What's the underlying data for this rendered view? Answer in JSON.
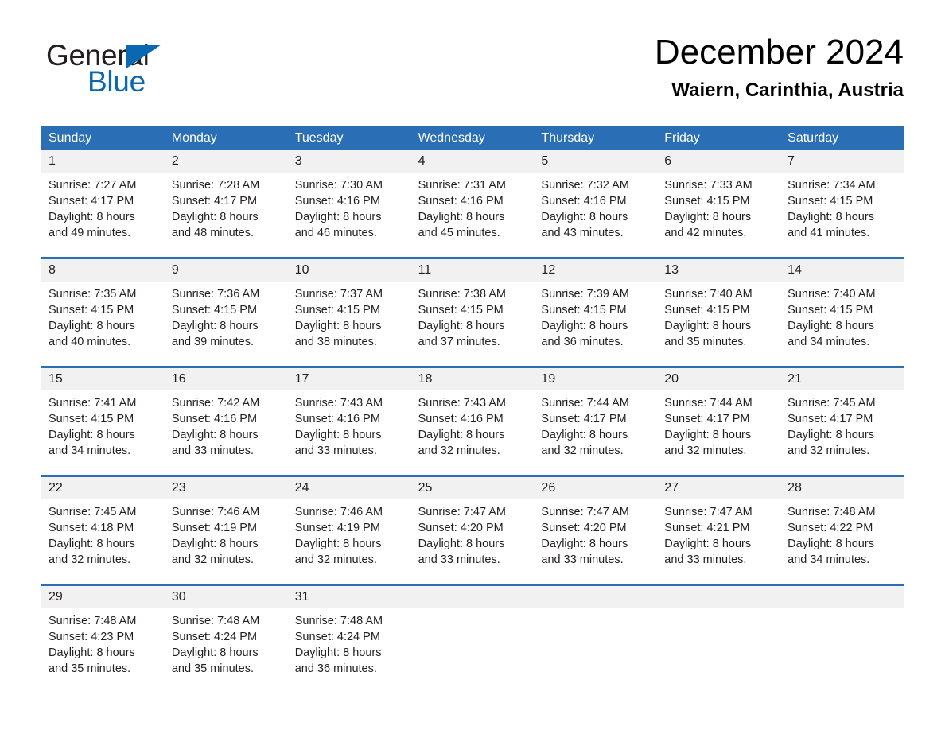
{
  "brand": {
    "name_part1": "General",
    "name_part2": "Blue",
    "triangle_color": "#0a67b1"
  },
  "header": {
    "title": "December 2024",
    "location": "Waiern, Carinthia, Austria"
  },
  "theme": {
    "header_blue": "#2a6fb5",
    "daynum_band": "#f1f1f1",
    "text": "#231f20"
  },
  "weekdays": [
    "Sunday",
    "Monday",
    "Tuesday",
    "Wednesday",
    "Thursday",
    "Friday",
    "Saturday"
  ],
  "weeks": [
    {
      "days": [
        {
          "num": "1",
          "sunrise": "Sunrise: 7:27 AM",
          "sunset": "Sunset: 4:17 PM",
          "daylight1": "Daylight: 8 hours",
          "daylight2": "and 49 minutes."
        },
        {
          "num": "2",
          "sunrise": "Sunrise: 7:28 AM",
          "sunset": "Sunset: 4:17 PM",
          "daylight1": "Daylight: 8 hours",
          "daylight2": "and 48 minutes."
        },
        {
          "num": "3",
          "sunrise": "Sunrise: 7:30 AM",
          "sunset": "Sunset: 4:16 PM",
          "daylight1": "Daylight: 8 hours",
          "daylight2": "and 46 minutes."
        },
        {
          "num": "4",
          "sunrise": "Sunrise: 7:31 AM",
          "sunset": "Sunset: 4:16 PM",
          "daylight1": "Daylight: 8 hours",
          "daylight2": "and 45 minutes."
        },
        {
          "num": "5",
          "sunrise": "Sunrise: 7:32 AM",
          "sunset": "Sunset: 4:16 PM",
          "daylight1": "Daylight: 8 hours",
          "daylight2": "and 43 minutes."
        },
        {
          "num": "6",
          "sunrise": "Sunrise: 7:33 AM",
          "sunset": "Sunset: 4:15 PM",
          "daylight1": "Daylight: 8 hours",
          "daylight2": "and 42 minutes."
        },
        {
          "num": "7",
          "sunrise": "Sunrise: 7:34 AM",
          "sunset": "Sunset: 4:15 PM",
          "daylight1": "Daylight: 8 hours",
          "daylight2": "and 41 minutes."
        }
      ]
    },
    {
      "days": [
        {
          "num": "8",
          "sunrise": "Sunrise: 7:35 AM",
          "sunset": "Sunset: 4:15 PM",
          "daylight1": "Daylight: 8 hours",
          "daylight2": "and 40 minutes."
        },
        {
          "num": "9",
          "sunrise": "Sunrise: 7:36 AM",
          "sunset": "Sunset: 4:15 PM",
          "daylight1": "Daylight: 8 hours",
          "daylight2": "and 39 minutes."
        },
        {
          "num": "10",
          "sunrise": "Sunrise: 7:37 AM",
          "sunset": "Sunset: 4:15 PM",
          "daylight1": "Daylight: 8 hours",
          "daylight2": "and 38 minutes."
        },
        {
          "num": "11",
          "sunrise": "Sunrise: 7:38 AM",
          "sunset": "Sunset: 4:15 PM",
          "daylight1": "Daylight: 8 hours",
          "daylight2": "and 37 minutes."
        },
        {
          "num": "12",
          "sunrise": "Sunrise: 7:39 AM",
          "sunset": "Sunset: 4:15 PM",
          "daylight1": "Daylight: 8 hours",
          "daylight2": "and 36 minutes."
        },
        {
          "num": "13",
          "sunrise": "Sunrise: 7:40 AM",
          "sunset": "Sunset: 4:15 PM",
          "daylight1": "Daylight: 8 hours",
          "daylight2": "and 35 minutes."
        },
        {
          "num": "14",
          "sunrise": "Sunrise: 7:40 AM",
          "sunset": "Sunset: 4:15 PM",
          "daylight1": "Daylight: 8 hours",
          "daylight2": "and 34 minutes."
        }
      ]
    },
    {
      "days": [
        {
          "num": "15",
          "sunrise": "Sunrise: 7:41 AM",
          "sunset": "Sunset: 4:15 PM",
          "daylight1": "Daylight: 8 hours",
          "daylight2": "and 34 minutes."
        },
        {
          "num": "16",
          "sunrise": "Sunrise: 7:42 AM",
          "sunset": "Sunset: 4:16 PM",
          "daylight1": "Daylight: 8 hours",
          "daylight2": "and 33 minutes."
        },
        {
          "num": "17",
          "sunrise": "Sunrise: 7:43 AM",
          "sunset": "Sunset: 4:16 PM",
          "daylight1": "Daylight: 8 hours",
          "daylight2": "and 33 minutes."
        },
        {
          "num": "18",
          "sunrise": "Sunrise: 7:43 AM",
          "sunset": "Sunset: 4:16 PM",
          "daylight1": "Daylight: 8 hours",
          "daylight2": "and 32 minutes."
        },
        {
          "num": "19",
          "sunrise": "Sunrise: 7:44 AM",
          "sunset": "Sunset: 4:17 PM",
          "daylight1": "Daylight: 8 hours",
          "daylight2": "and 32 minutes."
        },
        {
          "num": "20",
          "sunrise": "Sunrise: 7:44 AM",
          "sunset": "Sunset: 4:17 PM",
          "daylight1": "Daylight: 8 hours",
          "daylight2": "and 32 minutes."
        },
        {
          "num": "21",
          "sunrise": "Sunrise: 7:45 AM",
          "sunset": "Sunset: 4:17 PM",
          "daylight1": "Daylight: 8 hours",
          "daylight2": "and 32 minutes."
        }
      ]
    },
    {
      "days": [
        {
          "num": "22",
          "sunrise": "Sunrise: 7:45 AM",
          "sunset": "Sunset: 4:18 PM",
          "daylight1": "Daylight: 8 hours",
          "daylight2": "and 32 minutes."
        },
        {
          "num": "23",
          "sunrise": "Sunrise: 7:46 AM",
          "sunset": "Sunset: 4:19 PM",
          "daylight1": "Daylight: 8 hours",
          "daylight2": "and 32 minutes."
        },
        {
          "num": "24",
          "sunrise": "Sunrise: 7:46 AM",
          "sunset": "Sunset: 4:19 PM",
          "daylight1": "Daylight: 8 hours",
          "daylight2": "and 32 minutes."
        },
        {
          "num": "25",
          "sunrise": "Sunrise: 7:47 AM",
          "sunset": "Sunset: 4:20 PM",
          "daylight1": "Daylight: 8 hours",
          "daylight2": "and 33 minutes."
        },
        {
          "num": "26",
          "sunrise": "Sunrise: 7:47 AM",
          "sunset": "Sunset: 4:20 PM",
          "daylight1": "Daylight: 8 hours",
          "daylight2": "and 33 minutes."
        },
        {
          "num": "27",
          "sunrise": "Sunrise: 7:47 AM",
          "sunset": "Sunset: 4:21 PM",
          "daylight1": "Daylight: 8 hours",
          "daylight2": "and 33 minutes."
        },
        {
          "num": "28",
          "sunrise": "Sunrise: 7:48 AM",
          "sunset": "Sunset: 4:22 PM",
          "daylight1": "Daylight: 8 hours",
          "daylight2": "and 34 minutes."
        }
      ]
    },
    {
      "days": [
        {
          "num": "29",
          "sunrise": "Sunrise: 7:48 AM",
          "sunset": "Sunset: 4:23 PM",
          "daylight1": "Daylight: 8 hours",
          "daylight2": "and 35 minutes."
        },
        {
          "num": "30",
          "sunrise": "Sunrise: 7:48 AM",
          "sunset": "Sunset: 4:24 PM",
          "daylight1": "Daylight: 8 hours",
          "daylight2": "and 35 minutes."
        },
        {
          "num": "31",
          "sunrise": "Sunrise: 7:48 AM",
          "sunset": "Sunset: 4:24 PM",
          "daylight1": "Daylight: 8 hours",
          "daylight2": "and 36 minutes."
        },
        {
          "num": "",
          "sunrise": "",
          "sunset": "",
          "daylight1": "",
          "daylight2": ""
        },
        {
          "num": "",
          "sunrise": "",
          "sunset": "",
          "daylight1": "",
          "daylight2": ""
        },
        {
          "num": "",
          "sunrise": "",
          "sunset": "",
          "daylight1": "",
          "daylight2": ""
        },
        {
          "num": "",
          "sunrise": "",
          "sunset": "",
          "daylight1": "",
          "daylight2": ""
        }
      ]
    }
  ]
}
